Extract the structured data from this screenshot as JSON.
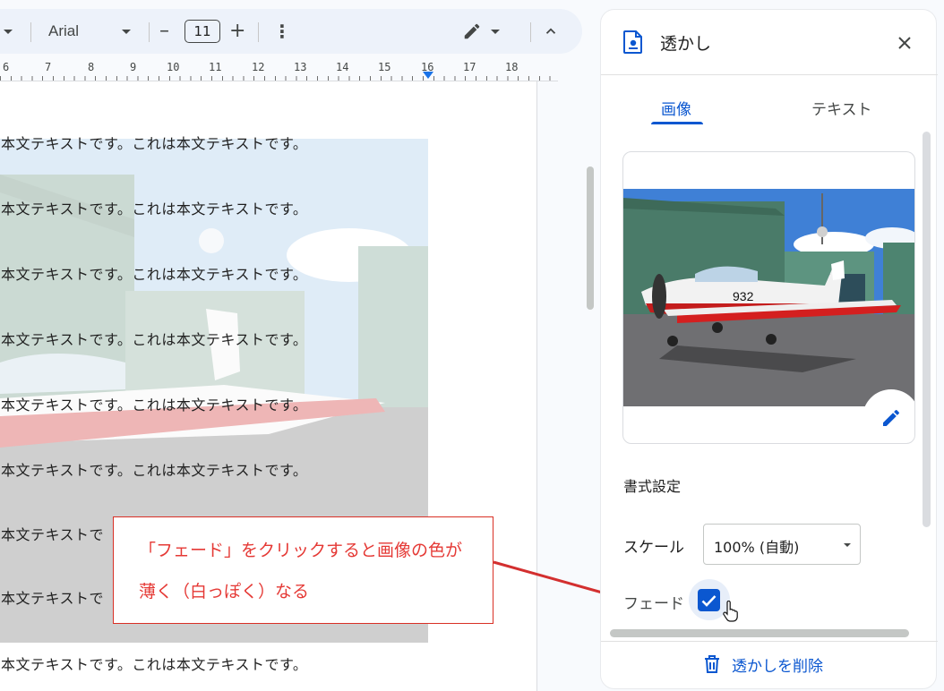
{
  "toolbar": {
    "font_name": "Arial",
    "font_size": "11",
    "minus_glyph": "–",
    "plus_glyph": "+",
    "more_glyph": "⋮"
  },
  "ruler": {
    "numbers": [
      "6",
      "7",
      "8",
      "9",
      "10",
      "11",
      "12",
      "13",
      "14",
      "15",
      "16",
      "17",
      "18"
    ]
  },
  "document": {
    "lines": [
      "本文テキストです。これは本文テキストです。",
      "本文テキストです。これは本文テキストです。",
      "本文テキストです。これは本文テキストです。",
      "本文テキストです。これは本文テキストです。",
      "本文テキストです。これは本文テキストです。",
      "本文テキストです。これは本文テキストです。",
      "本文テキストで",
      "本文テキストで",
      "本文テキストです。これは本文テキストです。"
    ]
  },
  "callout": {
    "line1": "「フェード」をクリックすると画像の色が",
    "line2": "薄く（白っぽく）なる"
  },
  "panel": {
    "title": "透かし",
    "tabs": [
      "画像",
      "テキスト"
    ],
    "active_tab": "画像",
    "section_label": "書式設定",
    "scale_label": "スケール",
    "scale_value": "100% (自動)",
    "fade_label": "フェード",
    "fade_checked": true,
    "delete_label": "透かしを削除"
  },
  "colors": {
    "accent": "#0b57d0",
    "callout_red": "#e53935",
    "toolbar_bg": "#edf2fa"
  },
  "icons": {
    "watermark": "document-watermark-icon",
    "close": "close-icon",
    "edit_image": "pencil-icon",
    "delete": "trash-icon",
    "more": "more-vert-icon",
    "pen_mode": "edit-mode-icon",
    "collapse": "chevron-up-icon"
  }
}
